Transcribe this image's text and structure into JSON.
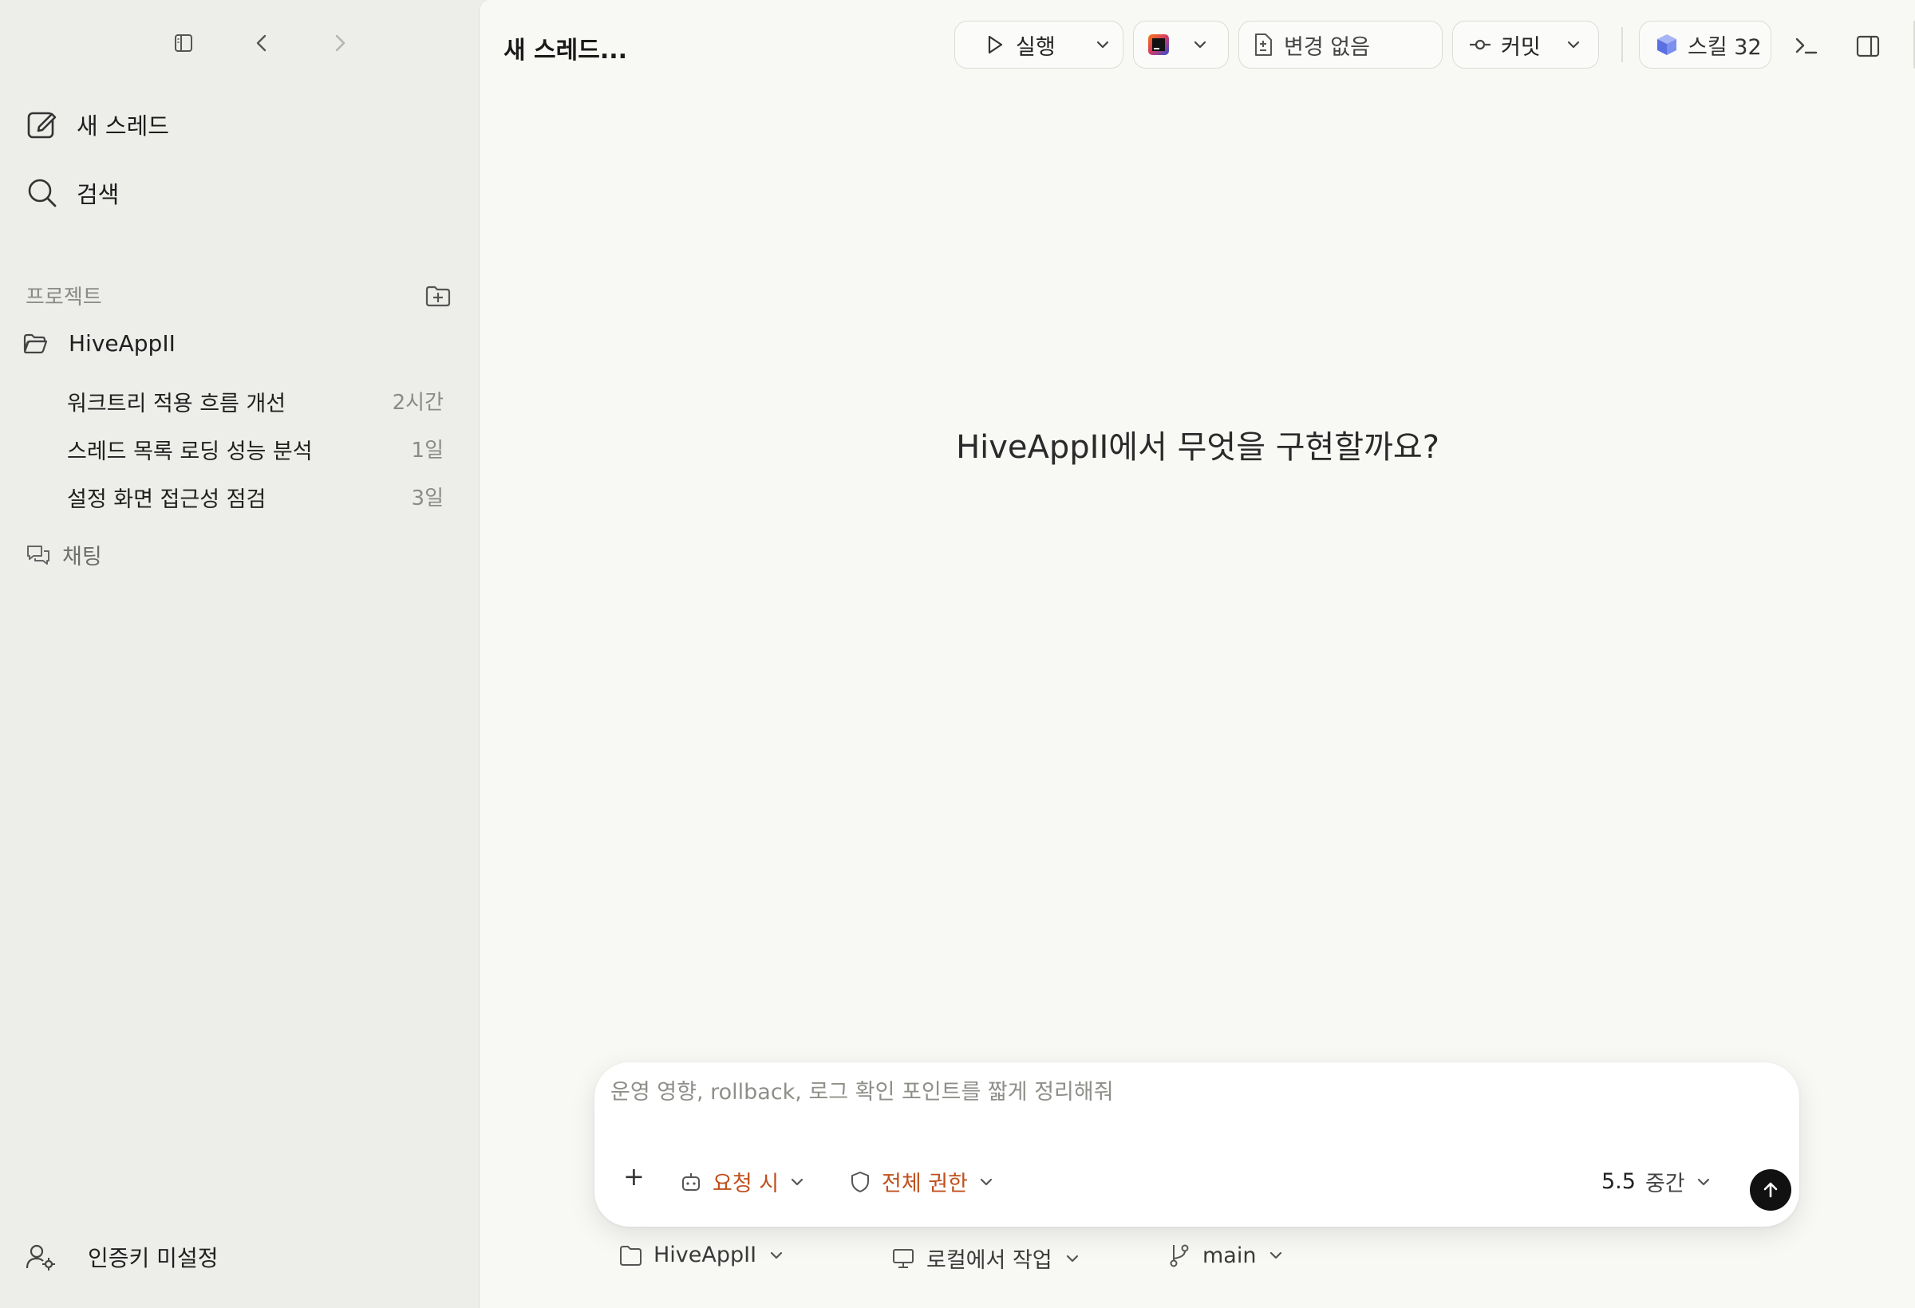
{
  "sidebar": {
    "new_thread_label": "새 스레드",
    "search_label": "검색",
    "projects_section_label": "프로젝트",
    "project": {
      "name": "HiveAppII",
      "threads": [
        {
          "title": "워크트리 적용 흐름 개선",
          "time": "2시간"
        },
        {
          "title": "스레드 목록 로딩 성능 분석",
          "time": "1일"
        },
        {
          "title": "설정 화면 접근성 점검",
          "time": "3일"
        }
      ]
    },
    "chat_label": "채팅",
    "auth_label": "인증키 미설정"
  },
  "header": {
    "thread_title": "새 스레드...",
    "run_label": "실행",
    "changes_label": "변경 없음",
    "commit_label": "커밋",
    "skills_label": "스킬 32"
  },
  "main": {
    "headline": "HiveAppII에서 무엇을 구현할까요?"
  },
  "composer": {
    "placeholder": "운영 영향, rollback, 로그 확인 포인트를 짧게 정리해줘",
    "add_label": "+",
    "mode_label": "요청 시",
    "permission_label": "전체 권한",
    "model_label": "5.5",
    "effort_label": "중간"
  },
  "context_bar": {
    "project_label": "HiveAppII",
    "location_label": "로컬에서 작업",
    "branch_label": "main"
  },
  "colors": {
    "accent_orange": "#c0501d",
    "sidebar_bg": "#ededea",
    "main_bg": "#f8f8f5",
    "send_button": "#111111"
  }
}
